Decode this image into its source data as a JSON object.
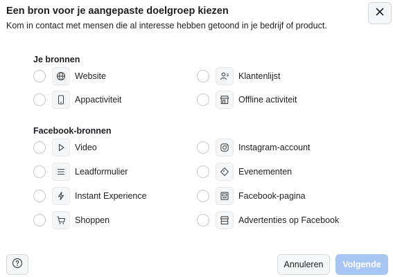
{
  "dialog": {
    "title": "Een bron voor je aangepaste doelgroep kiezen",
    "subtitle": "Kom in contact met mensen die al interesse hebben getoond in je bedrijf of product."
  },
  "sections": {
    "own": {
      "title": "Je bronnen",
      "options": [
        {
          "label": "Website",
          "icon": "globe-icon"
        },
        {
          "label": "Klantenlijst",
          "icon": "customer-list-icon"
        },
        {
          "label": "Appactiviteit",
          "icon": "phone-icon"
        },
        {
          "label": "Offline activiteit",
          "icon": "store-icon"
        }
      ]
    },
    "facebook": {
      "title": "Facebook-bronnen",
      "options": [
        {
          "label": "Video",
          "icon": "play-icon"
        },
        {
          "label": "Instagram-account",
          "icon": "instagram-icon"
        },
        {
          "label": "Leadformulier",
          "icon": "lines-icon"
        },
        {
          "label": "Evenementen",
          "icon": "ticket-icon"
        },
        {
          "label": "Instant Experience",
          "icon": "lightning-icon"
        },
        {
          "label": "Facebook-pagina",
          "icon": "page-icon"
        },
        {
          "label": "Shoppen",
          "icon": "cart-icon"
        },
        {
          "label": "Advertenties op Facebook",
          "icon": "shop-icon"
        }
      ]
    }
  },
  "footer": {
    "cancel_label": "Annuleren",
    "next_label": "Volgende"
  },
  "colors": {
    "primary_disabled": "#a7c6f3",
    "text": "#1c1e21",
    "border": "#d6d9dd"
  }
}
